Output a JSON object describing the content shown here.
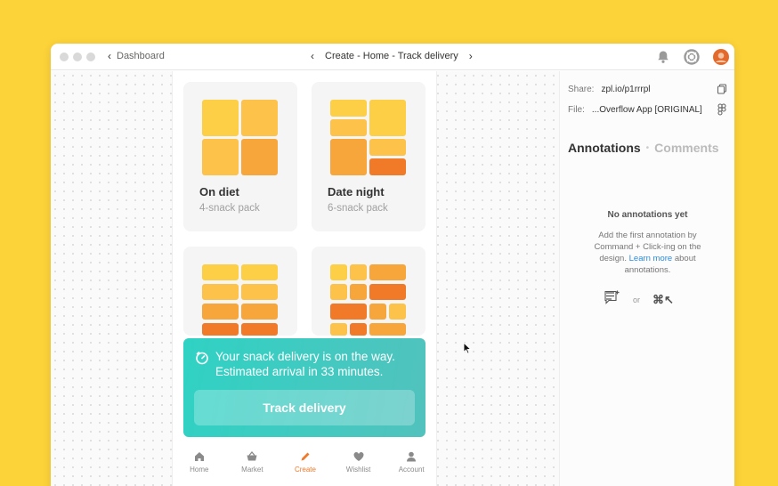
{
  "titlebar": {
    "breadcrumb": "Dashboard",
    "title": "Create - Home - Track delivery"
  },
  "icons": {
    "notifications": "bell-icon",
    "help": "lifebuoy-icon",
    "avatar": "user-avatar"
  },
  "phone": {
    "cards": [
      {
        "name": "On diet",
        "subtitle": "4-snack pack"
      },
      {
        "name": "Date night",
        "subtitle": "6-snack pack"
      }
    ],
    "delivery": {
      "message": "Your snack delivery is on the way. Estimated arrival in 33 minutes.",
      "button": "Track delivery"
    },
    "tabs": [
      {
        "label": "Home",
        "icon": "home-icon"
      },
      {
        "label": "Market",
        "icon": "basket-icon"
      },
      {
        "label": "Create",
        "icon": "pencil-icon",
        "active": true
      },
      {
        "label": "Wishlist",
        "icon": "heart-icon"
      },
      {
        "label": "Account",
        "icon": "person-icon"
      }
    ]
  },
  "panel": {
    "share_label": "Share:",
    "share_value": "zpl.io/p1rrrpl",
    "file_label": "File:",
    "file_value": "...Overflow App [ORIGINAL]",
    "tabs": [
      "Annotations",
      "Comments"
    ],
    "empty_title": "No annotations yet",
    "empty_desc_before": "Add the first annotation by Command + Click-ing on the design.",
    "empty_link": "Learn more",
    "empty_desc_after": "about annotations.",
    "or": "or",
    "shortcut": "⌘↖"
  },
  "colors": {
    "background": "#FDD33A",
    "accent": "#ee7a2a",
    "teal": "#2fd2c4",
    "link": "#2b8cdc"
  }
}
